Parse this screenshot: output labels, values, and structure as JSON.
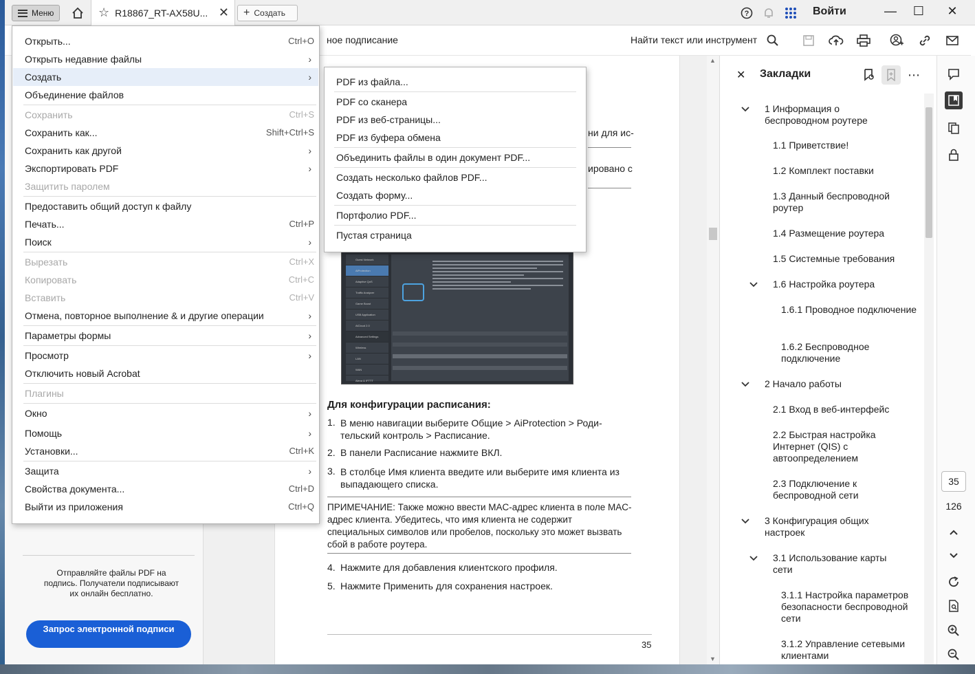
{
  "topbar": {
    "menu_label": "Меню",
    "tab_title": "R18867_RT-AX58U...",
    "create_label": "Создать",
    "login_label": "Войти"
  },
  "toolbar": {
    "title_fragment": "ное подписание",
    "find_label": "Найти текст или инструмент"
  },
  "main_menu": {
    "items": [
      {
        "label": "Открыть...",
        "shortcut": "Ctrl+O",
        "disabled": false,
        "submenu": false
      },
      {
        "label": "Открыть недавние файлы",
        "shortcut": "",
        "disabled": false,
        "submenu": true
      },
      {
        "label": "Создать",
        "shortcut": "",
        "disabled": false,
        "submenu": true,
        "highlighted": true
      },
      {
        "label": "Объединение файлов",
        "shortcut": "",
        "disabled": false,
        "submenu": false
      },
      {
        "label": "Сохранить",
        "shortcut": "Ctrl+S",
        "disabled": true,
        "submenu": false
      },
      {
        "label": "Сохранить как...",
        "shortcut": "Shift+Ctrl+S",
        "disabled": false,
        "submenu": false
      },
      {
        "label": "Сохранить как другой",
        "shortcut": "",
        "disabled": false,
        "submenu": true
      },
      {
        "label": "Экспортировать PDF",
        "shortcut": "",
        "disabled": false,
        "submenu": true
      },
      {
        "label": "Защитить паролем",
        "shortcut": "",
        "disabled": true,
        "submenu": false
      },
      {
        "label": "Предоставить общий доступ к файлу",
        "shortcut": "",
        "disabled": false,
        "submenu": false
      },
      {
        "label": "Печать...",
        "shortcut": "Ctrl+P",
        "disabled": false,
        "submenu": false
      },
      {
        "label": "Поиск",
        "shortcut": "",
        "disabled": false,
        "submenu": true
      },
      {
        "label": "Вырезать",
        "shortcut": "Ctrl+X",
        "disabled": true,
        "submenu": false
      },
      {
        "label": "Копировать",
        "shortcut": "Ctrl+C",
        "disabled": true,
        "submenu": false
      },
      {
        "label": "Вставить",
        "shortcut": "Ctrl+V",
        "disabled": true,
        "submenu": false
      },
      {
        "label": "Отмена, повторное выполнение & и другие операции",
        "shortcut": "",
        "disabled": false,
        "submenu": true
      },
      {
        "label": "Параметры формы",
        "shortcut": "",
        "disabled": false,
        "submenu": true
      },
      {
        "label": "Просмотр",
        "shortcut": "",
        "disabled": false,
        "submenu": true
      },
      {
        "label": "Отключить новый Acrobat",
        "shortcut": "",
        "disabled": false,
        "submenu": false
      },
      {
        "label": "Плагины",
        "shortcut": "",
        "disabled": true,
        "submenu": false
      },
      {
        "label": "Окно",
        "shortcut": "",
        "disabled": false,
        "submenu": true
      },
      {
        "label": "Помощь",
        "shortcut": "",
        "disabled": false,
        "submenu": true
      },
      {
        "label": "Установки...",
        "shortcut": "Ctrl+K",
        "disabled": false,
        "submenu": false
      },
      {
        "label": "Защита",
        "shortcut": "",
        "disabled": false,
        "submenu": true
      },
      {
        "label": "Свойства документа...",
        "shortcut": "Ctrl+D",
        "disabled": false,
        "submenu": false
      },
      {
        "label": "Выйти из приложения",
        "shortcut": "Ctrl+Q",
        "disabled": false,
        "submenu": false
      }
    ]
  },
  "sub_menu": {
    "items": [
      "PDF из файла...",
      "PDF со сканера",
      "PDF из веб-страницы...",
      "PDF из буфера обмена",
      "Объединить файлы в один документ PDF...",
      "Создать несколько файлов PDF...",
      "Создать форму...",
      "Портфолио PDF...",
      "Пустая страница"
    ]
  },
  "left_panel": {
    "sign_text": "Отправляйте файлы PDF на подпись. Получатели подписывают их онлайн бесплатно.",
    "sign_button": "Запрос электронной подписи"
  },
  "document": {
    "frag1": "ни для ис-",
    "frag2": "ировано с",
    "heading": "Для конфигурации расписания:",
    "steps": [
      {
        "num": "1.",
        "text": "В меню навигации выберите Общие > AiProtection > Роди-тельский контроль > Расписание."
      },
      {
        "num": "2.",
        "text": "В панели Расписание нажмите ВКЛ."
      },
      {
        "num": "3.",
        "text": "В столбце Имя клиента введите или выберите имя клиента из выпадающего списка."
      }
    ],
    "note": "ПРИМЕЧАНИЕ: Также можно ввести MAC-адрес клиента в поле MAC-адрес клиента. Убедитесь, что имя клиента не содержит специальных символов или пробелов, поскольку это может вызвать сбой в работе роутера.",
    "steps2": [
      {
        "num": "4.",
        "text": "Нажмите  для добавления клиентского профиля."
      },
      {
        "num": "5.",
        "text": "Нажмите Применить для сохранения настроек."
      }
    ],
    "page_number": "35",
    "screenshot_menu": [
      "Guest Network",
      "AiProtection",
      "Adaptive QoS",
      "Traffic Analyzer",
      "Game Boost",
      "USB Application",
      "AiCloud 2.0",
      "Advanced Settings",
      "Wireless",
      "LAN",
      "WAN",
      "Alexa & IFTTT"
    ]
  },
  "bookmarks": {
    "title": "Закладки",
    "items": [
      {
        "label": "1 Информация о беспроводном роутере",
        "level": 0,
        "expanded": true
      },
      {
        "label": "1.1 Приветствие!",
        "level": 1
      },
      {
        "label": "1.2 Комплект поставки",
        "level": 1
      },
      {
        "label": "1.3 Данный беспроводной роутер",
        "level": 1
      },
      {
        "label": "1.4 Размещение роутера",
        "level": 1
      },
      {
        "label": "1.5 Системные требования",
        "level": 1
      },
      {
        "label": "1.6 Настройка роутера",
        "level": 1,
        "expanded": true
      },
      {
        "label": "1.6.1 Проводное подключение",
        "level": 2
      },
      {
        "label": "1.6.2 Беспроводное подключение",
        "level": 2
      },
      {
        "label": "2 Начало работы",
        "level": 0,
        "expanded": true
      },
      {
        "label": "2.1 Вход в веб-интерфейс",
        "level": 1
      },
      {
        "label": "2.2 Быстрая настройка Интернет (QIS) с автоопределением",
        "level": 1
      },
      {
        "label": "2.3 Подключение к беспроводной сети",
        "level": 1
      },
      {
        "label": "3 Конфигурация общих настроек",
        "level": 0,
        "expanded": true
      },
      {
        "label": "3.1 Использование карты сети",
        "level": 1,
        "expanded": true
      },
      {
        "label": "3.1.1 Настройка параметров безопасности беспроводной сети",
        "level": 2
      },
      {
        "label": "3.1.2 Управление сетевыми клиентами",
        "level": 2
      }
    ]
  },
  "rail": {
    "current_page": "35",
    "total_pages": "126"
  }
}
